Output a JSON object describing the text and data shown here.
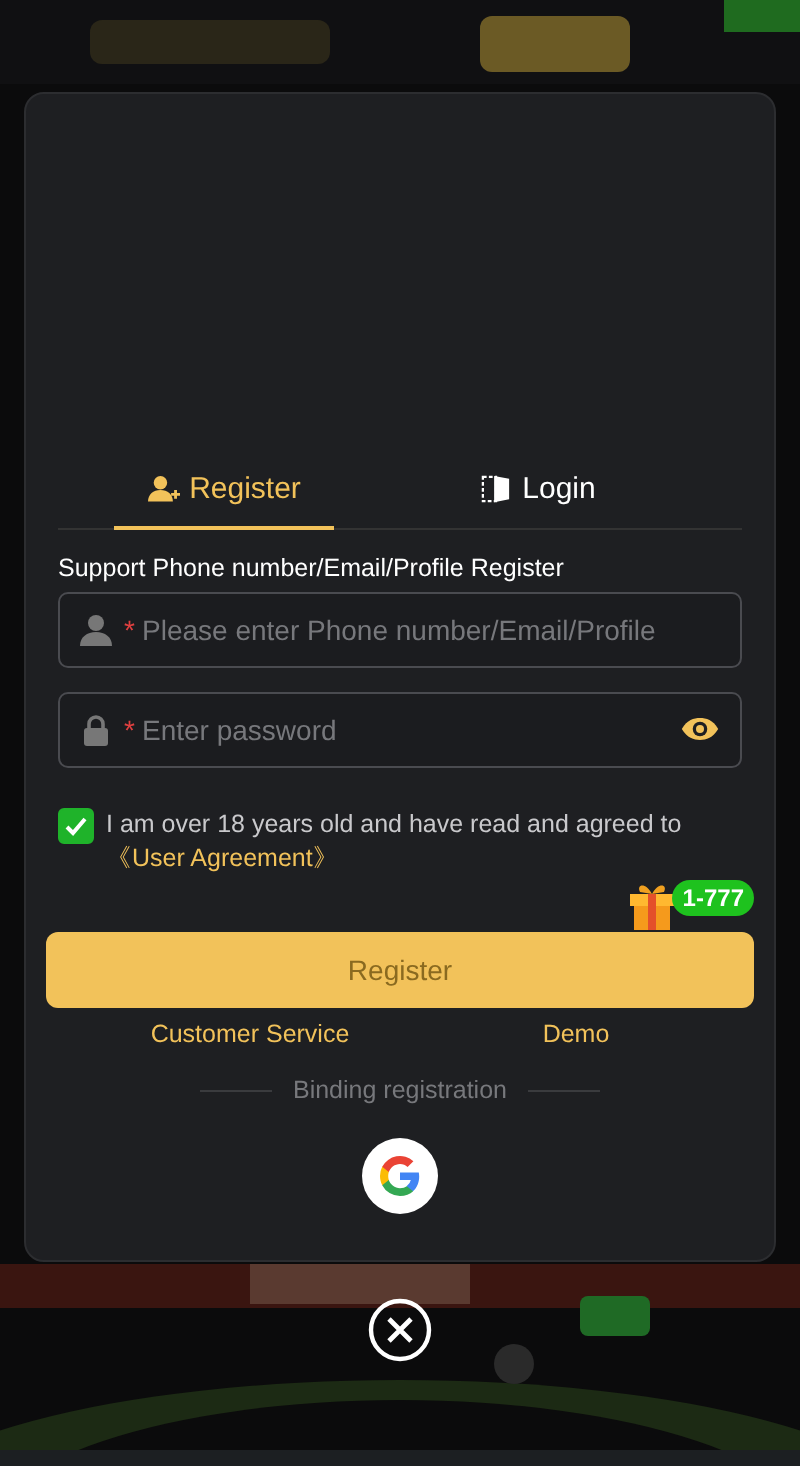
{
  "tabs": [
    {
      "label": "Register",
      "selected": true,
      "kind": "register"
    },
    {
      "label": "Login",
      "selected": false,
      "kind": "login"
    }
  ],
  "form": {
    "hint": "Support Phone number/Email/Profile Register",
    "fields": [
      {
        "kind": "account",
        "required_mark": "*",
        "placeholder": "Please enter Phone number/Email/Profile"
      },
      {
        "kind": "password",
        "required_mark": "*",
        "placeholder": "Enter password"
      }
    ]
  },
  "agreement": {
    "checked": true,
    "text": "I am over 18 years old and have read and agreed to",
    "link": "《User Agreement》"
  },
  "bonus_badge": "1-777",
  "register_button": "Register",
  "links": [
    "Customer Service",
    "Demo"
  ],
  "binding_label": "Binding registration",
  "social": [
    {
      "kind": "google"
    }
  ]
}
